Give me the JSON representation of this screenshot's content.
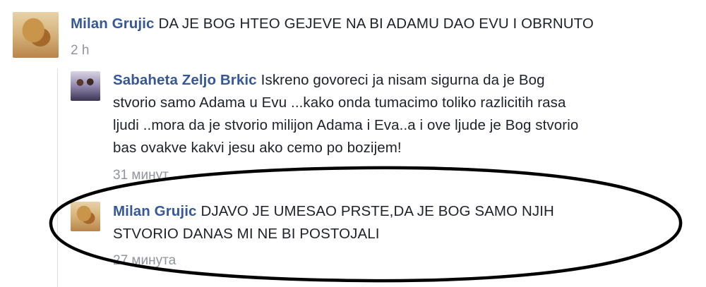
{
  "comments": [
    {
      "author": "Milan Grujic",
      "text": "DA JE BOG HTEO GEJEVE NA BI ADAMU DAO EVU I OBRNUTO",
      "time": "2 h"
    },
    {
      "author": "Sabaheta Zeljo Brkic",
      "text_lines": [
        "Iskreno govoreci ja nisam sigurna da je Bog",
        "stvorio samo Adama u Evu ...kako onda tumacimo toliko razlicitih rasa",
        "ljudi ..mora da je stvorio milijon Adama i Eva..a i ove ljude je Bog stvorio",
        "bas ovakve kakvi jesu ako cemo po bozijem!"
      ],
      "time": "31 минут"
    },
    {
      "author": "Milan Grujic",
      "text_lines": [
        "DJAVO JE UMESAO PRSTE,DA JE BOG SAMO NJIH",
        "STVORIO DANAS MI NE BI POSTOJALI"
      ],
      "time": "27 минута"
    }
  ],
  "colors": {
    "author": "#365899",
    "text": "#1d2129",
    "meta": "#90949c",
    "annotation": "#000000"
  }
}
